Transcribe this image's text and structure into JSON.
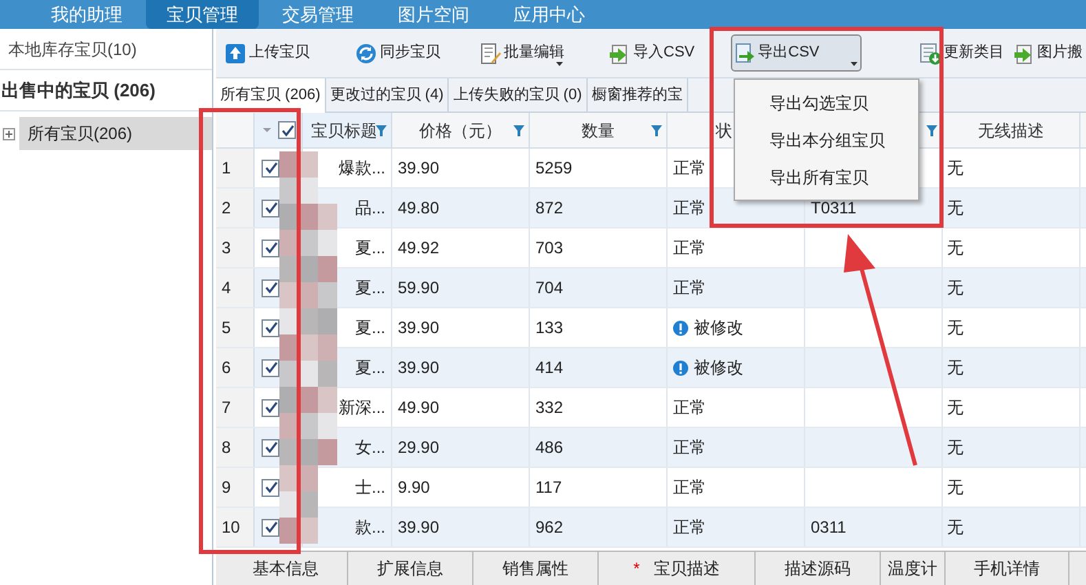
{
  "nav": {
    "tabs": [
      {
        "label": "我的助理",
        "selected": false
      },
      {
        "label": "宝贝管理",
        "selected": true
      },
      {
        "label": "交易管理",
        "selected": false
      },
      {
        "label": "图片空间",
        "selected": false
      },
      {
        "label": "应用中心",
        "selected": false
      }
    ]
  },
  "sidebar": {
    "items": [
      {
        "label": "本地库存宝贝(10)",
        "kind": "plain"
      },
      {
        "label": "出售中的宝贝 (206)",
        "kind": "header"
      }
    ],
    "tree": [
      {
        "label": "所有宝贝(206)",
        "selected": true,
        "expanded": false
      }
    ]
  },
  "toolbar": {
    "buttons": [
      {
        "label": "上传宝贝",
        "kind": "upload",
        "dropdown": false,
        "pressed": false
      },
      {
        "label": "同步宝贝",
        "kind": "sync",
        "dropdown": false,
        "pressed": false
      },
      {
        "label": "批量编辑",
        "kind": "edit",
        "dropdown": true,
        "pressed": false
      },
      {
        "label": "导入CSV",
        "kind": "import",
        "dropdown": false,
        "pressed": false
      },
      {
        "label": "导出CSV",
        "kind": "export",
        "dropdown": true,
        "pressed": true
      },
      {
        "label": "更新类目",
        "kind": "update",
        "dropdown": false,
        "pressed": false
      },
      {
        "label": "图片搬",
        "kind": "import",
        "dropdown": false,
        "pressed": false
      }
    ]
  },
  "tabs": [
    {
      "label": "所有宝贝 (206)",
      "selected": true
    },
    {
      "label": "更改过的宝贝 (4)",
      "selected": false
    },
    {
      "label": "上传失败的宝贝 (0)",
      "selected": false
    },
    {
      "label": "橱窗推荐的宝",
      "selected": false
    }
  ],
  "table": {
    "header_checked": true,
    "columns": [
      {
        "label": "宝贝标题",
        "filter": true
      },
      {
        "label": "价格（元）",
        "filter": true
      },
      {
        "label": "数量",
        "filter": true
      },
      {
        "label": "状",
        "filter": false
      },
      {
        "filter": true
      },
      {
        "label": "无线描述",
        "filter": false
      }
    ],
    "rows": [
      {
        "number": "1",
        "checked": true,
        "title": "爆款...",
        "price": "39.90",
        "quantity": "5259",
        "status": "正常",
        "kind": "normal",
        "wireless": "无"
      },
      {
        "number": "2",
        "checked": true,
        "title": "品...",
        "price": "49.80",
        "quantity": "872",
        "status": "正常",
        "kind": "normal",
        "column_5": "T0311",
        "wireless": "无"
      },
      {
        "number": "3",
        "checked": true,
        "title": "夏...",
        "price": "49.92",
        "quantity": "703",
        "status": "正常",
        "kind": "normal",
        "wireless": "无"
      },
      {
        "number": "4",
        "checked": true,
        "title": "夏...",
        "price": "59.90",
        "quantity": "704",
        "status": "正常",
        "kind": "normal",
        "wireless": "无"
      },
      {
        "number": "5",
        "checked": true,
        "title": "夏...",
        "price": "39.90",
        "quantity": "133",
        "status": "被修改",
        "kind": "modified",
        "wireless": "无"
      },
      {
        "number": "6",
        "checked": true,
        "title": "夏...",
        "price": "39.90",
        "quantity": "414",
        "status": "被修改",
        "kind": "modified",
        "wireless": "无"
      },
      {
        "number": "7",
        "checked": true,
        "title": "新深...",
        "price": "49.90",
        "quantity": "332",
        "status": "正常",
        "kind": "normal",
        "wireless": "无"
      },
      {
        "number": "8",
        "checked": true,
        "title": "女...",
        "price": "29.90",
        "quantity": "486",
        "status": "正常",
        "kind": "normal",
        "wireless": "无"
      },
      {
        "number": "9",
        "checked": true,
        "title": "士...",
        "price": "9.90",
        "quantity": "117",
        "status": "正常",
        "kind": "normal",
        "wireless": "无"
      },
      {
        "number": "10",
        "checked": true,
        "title": "款...",
        "price": "39.90",
        "quantity": "962",
        "status": "正常",
        "kind": "normal",
        "column_5": "0311",
        "wireless": "无"
      }
    ]
  },
  "dropdown_menu": {
    "items": [
      {
        "label": "导出勾选宝贝"
      },
      {
        "label": "导出本分组宝贝"
      },
      {
        "label": "导出所有宝贝"
      }
    ]
  },
  "bottom_tabs": [
    {
      "label": "基本信息",
      "required": false
    },
    {
      "label": "扩展信息",
      "required": false
    },
    {
      "label": "销售属性",
      "required": false
    },
    {
      "label": "宝贝描述",
      "required": true,
      "marker": "*"
    },
    {
      "label": "描述源码",
      "required": false
    },
    {
      "label": "温度计",
      "required": false
    },
    {
      "label": "手机详情",
      "required": false
    }
  ]
}
